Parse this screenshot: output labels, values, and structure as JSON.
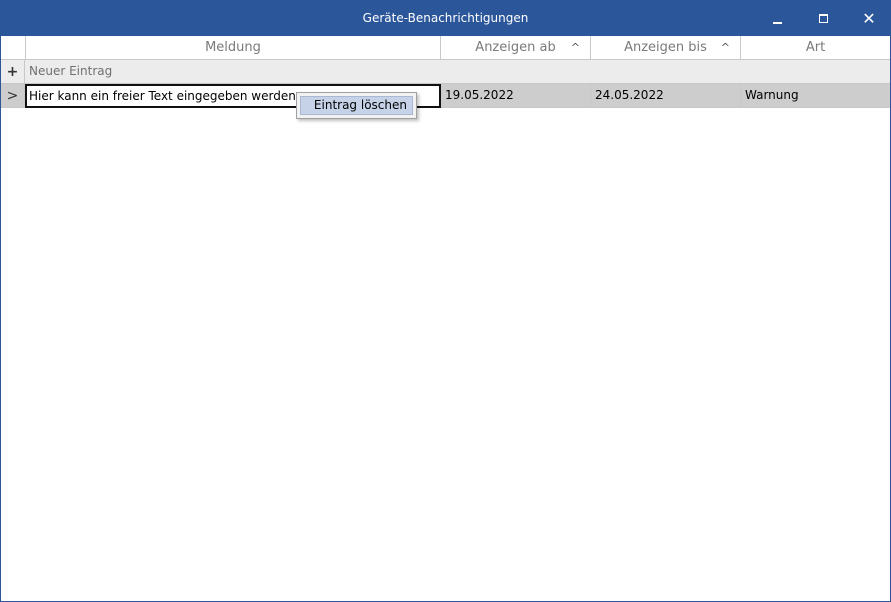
{
  "window": {
    "title": "Geräte-Benachrichtigungen"
  },
  "title_buttons": {
    "minimize_icon": "minimize-icon",
    "maximize_icon": "maximize-icon",
    "close_icon": "close-icon",
    "close_glyph": "✕"
  },
  "grid": {
    "columns": [
      {
        "label": "Meldung",
        "sortable": false
      },
      {
        "label": "Anzeigen ab",
        "sortable": true,
        "sort_glyph": "^"
      },
      {
        "label": "Anzeigen bis",
        "sortable": true,
        "sort_glyph": "^"
      },
      {
        "label": "Art",
        "sortable": false
      }
    ],
    "new_row": {
      "indicator": "+",
      "placeholder": "Neuer Eintrag"
    },
    "rows": [
      {
        "indicator": ">",
        "meldung": "Hier kann ein freier Text eingegeben werden.",
        "anzeigen_ab": "19.05.2022",
        "anzeigen_bis": "24.05.2022",
        "art": "Warnung"
      }
    ]
  },
  "context_menu": {
    "items": [
      {
        "label": "Eintrag löschen"
      }
    ]
  },
  "colors": {
    "titlebar": "#2b579a",
    "row_selected": "#cdcdcd",
    "new_row": "#ececec",
    "menu_highlight": "#c5d2e7"
  }
}
